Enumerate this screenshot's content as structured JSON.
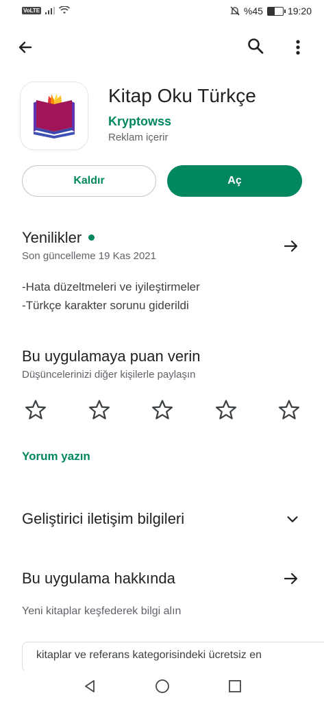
{
  "status": {
    "volte": "VoLTE",
    "battery": "%45",
    "battery_level": 0.45,
    "time": "19:20"
  },
  "app": {
    "title": "Kitap Oku Türkçe",
    "developer": "Kryptowss",
    "ads_note": "Reklam içerir"
  },
  "actions": {
    "uninstall_label": "Kaldır",
    "open_label": "Aç"
  },
  "whats_new": {
    "title": "Yenilikler",
    "updated": "Son güncelleme 19 Kas 2021",
    "notes": [
      "-Hata düzeltmeleri ve iyileştirmeler",
      "-Türkçe karakter sorunu giderildi"
    ]
  },
  "rating": {
    "title": "Bu uygulamaya puan verin",
    "subtitle": "Düşüncelerinizi diğer kişilerle paylaşın",
    "stars": 5,
    "write_review": "Yorum yazın"
  },
  "developer_contact": {
    "title": "Geliştirici iletişim bilgileri"
  },
  "about": {
    "title": "Bu uygulama hakkında",
    "summary": "Yeni kitaplar keşfederek bilgi alın",
    "description_snippet": "kitaplar ve referans kategorisindeki ücretsiz en"
  },
  "colors": {
    "accent": "#01875f",
    "text": "#202124",
    "secondary": "#5f6368"
  },
  "icons": [
    "back-arrow-icon",
    "search-icon",
    "more-vert-icon",
    "arrow-right-icon",
    "star-outline-icon",
    "chevron-down-icon",
    "nav-back-icon",
    "nav-home-icon",
    "nav-recents-icon"
  ]
}
